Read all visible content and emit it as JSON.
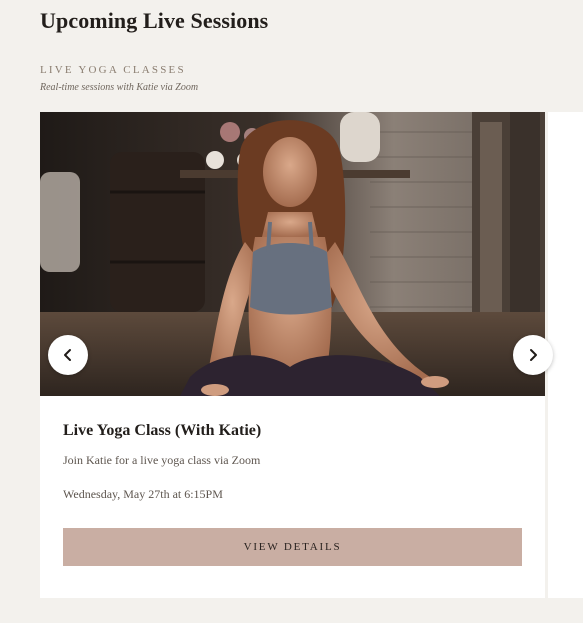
{
  "page": {
    "title": "Upcoming Live Sessions"
  },
  "section": {
    "heading": "LIVE YOGA CLASSES",
    "subheading": "Real-time sessions with Katie via Zoom"
  },
  "carousel": {
    "prev_icon": "chevron-left-icon",
    "next_icon": "chevron-right-icon",
    "card": {
      "image_subject": "woman-meditating-photo",
      "title": "Live Yoga Class (With Katie)",
      "description": "Join Katie for a live yoga class via Zoom",
      "date": "Wednesday, May 27th at 6:15PM",
      "button_label": "VIEW DETAILS"
    }
  },
  "colors": {
    "background": "#f3f1ed",
    "card": "#ffffff",
    "button": "#c9aea3",
    "accent_text": "#8a7d70"
  }
}
